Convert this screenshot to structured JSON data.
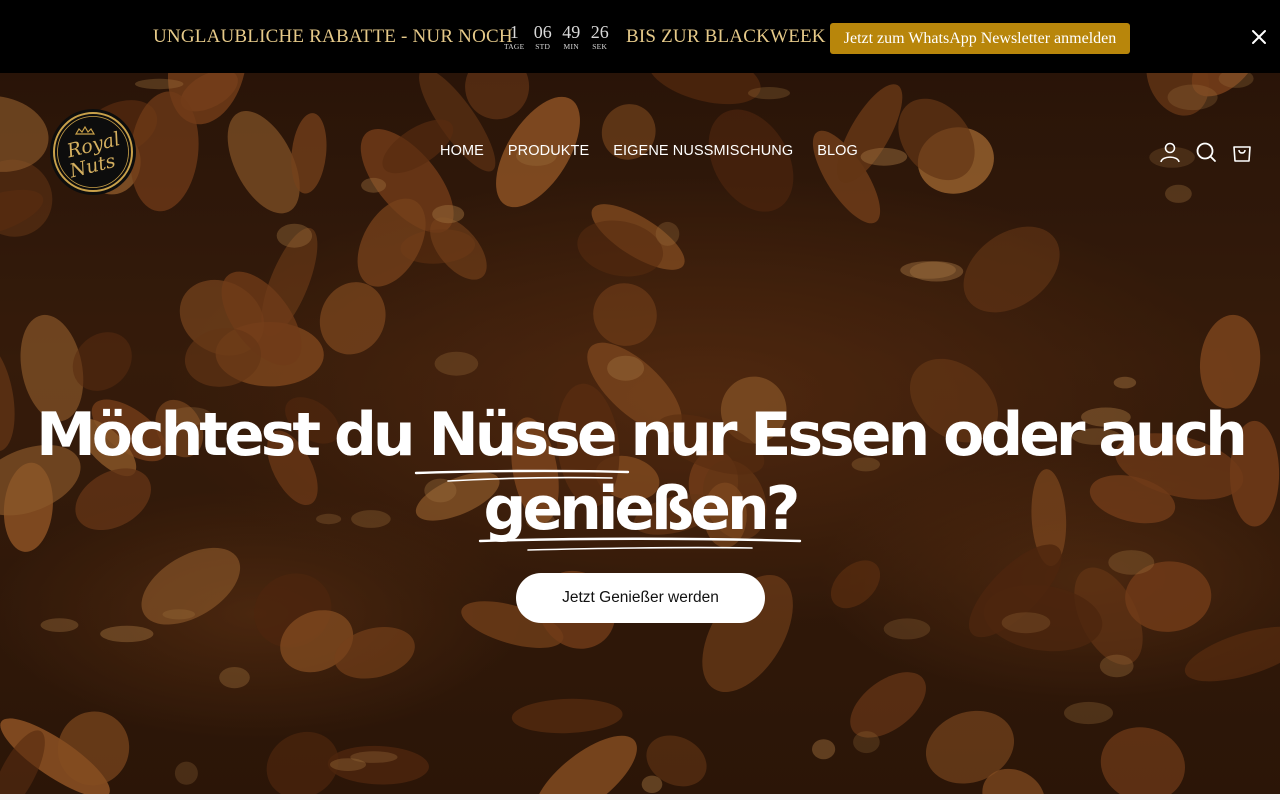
{
  "announcement": {
    "lead": "UNGLAUBLICHE RABATTE - NUR NOCH",
    "tail": "BIS ZUR BLACKWEEK",
    "countdown": [
      {
        "value": "1",
        "label": "TAGE"
      },
      {
        "value": "06",
        "label": "STD"
      },
      {
        "value": "49",
        "label": "MIN"
      },
      {
        "value": "26",
        "label": "SEK"
      }
    ],
    "newsletter_button": "Jetzt zum WhatsApp Newsletter anmelden",
    "close_icon": "close-icon"
  },
  "header": {
    "logo": {
      "line1": "Royal",
      "line2": "Nuts"
    },
    "nav": [
      "HOME",
      "PRODUKTE",
      "EIGENE NUSSMISCHUNG",
      "BLOG"
    ],
    "icons": [
      "account-icon",
      "search-icon",
      "cart-icon"
    ]
  },
  "hero": {
    "headline_line1_a": "Möchtest du ",
    "headline_line1_b": "Nüsse",
    "headline_line1_c": " nur Essen oder auch",
    "headline_line2": "genießen?",
    "cta_label": "Jetzt Genießer werden"
  },
  "colors": {
    "accent_gold": "#b8860b",
    "announcement_text": "#e5c989",
    "announcement_bg": "#000000"
  }
}
